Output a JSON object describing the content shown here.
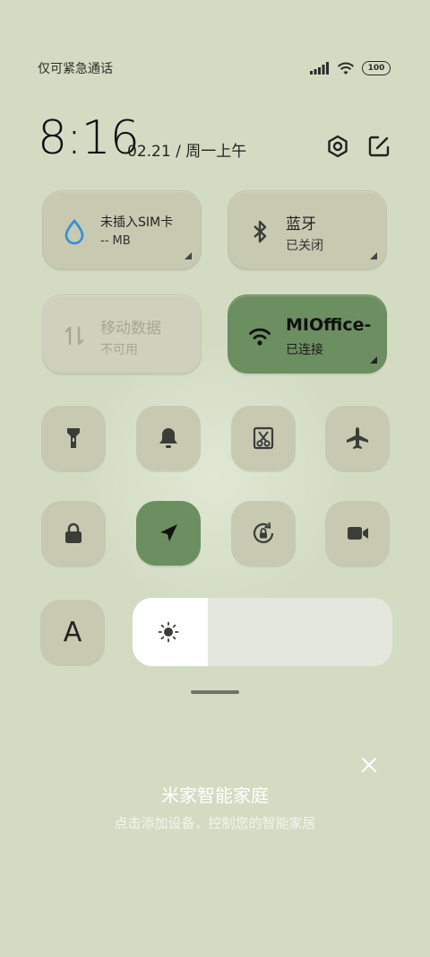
{
  "status_bar": {
    "carrier": "仅可紧急通话",
    "battery": "100"
  },
  "header": {
    "time": "8:16",
    "date": "02.21 / 周一上午"
  },
  "tiles": [
    {
      "title": "未插入SIM卡",
      "sub": "-- MB",
      "state": "normal",
      "icon": "water-drop-icon"
    },
    {
      "title": "蓝牙",
      "sub": "已关闭",
      "state": "normal",
      "icon": "bluetooth-icon"
    },
    {
      "title": "移动数据",
      "sub": "不可用",
      "state": "disabled",
      "icon": "mobile-data-icon"
    },
    {
      "title": "MIOffice-",
      "sub": "已连接",
      "state": "active",
      "icon": "wifi-icon"
    }
  ],
  "toggles": [
    {
      "icon": "flashlight-icon",
      "active": false
    },
    {
      "icon": "bell-icon",
      "active": false
    },
    {
      "icon": "screenshot-icon",
      "active": false
    },
    {
      "icon": "airplane-icon",
      "active": false
    },
    {
      "icon": "lock-icon",
      "active": false
    },
    {
      "icon": "location-icon",
      "active": true
    },
    {
      "icon": "rotation-lock-icon",
      "active": false
    },
    {
      "icon": "video-camera-icon",
      "active": false
    }
  ],
  "font_button": "A",
  "brightness": {
    "level": 0.29
  },
  "smart_home": {
    "title": "米家智能家庭",
    "subtitle": "点击添加设备，控制您的智能家居"
  },
  "colors": {
    "background": "#d3dcc3",
    "tile": "#c7c9b0",
    "active": "#6c8f61"
  }
}
